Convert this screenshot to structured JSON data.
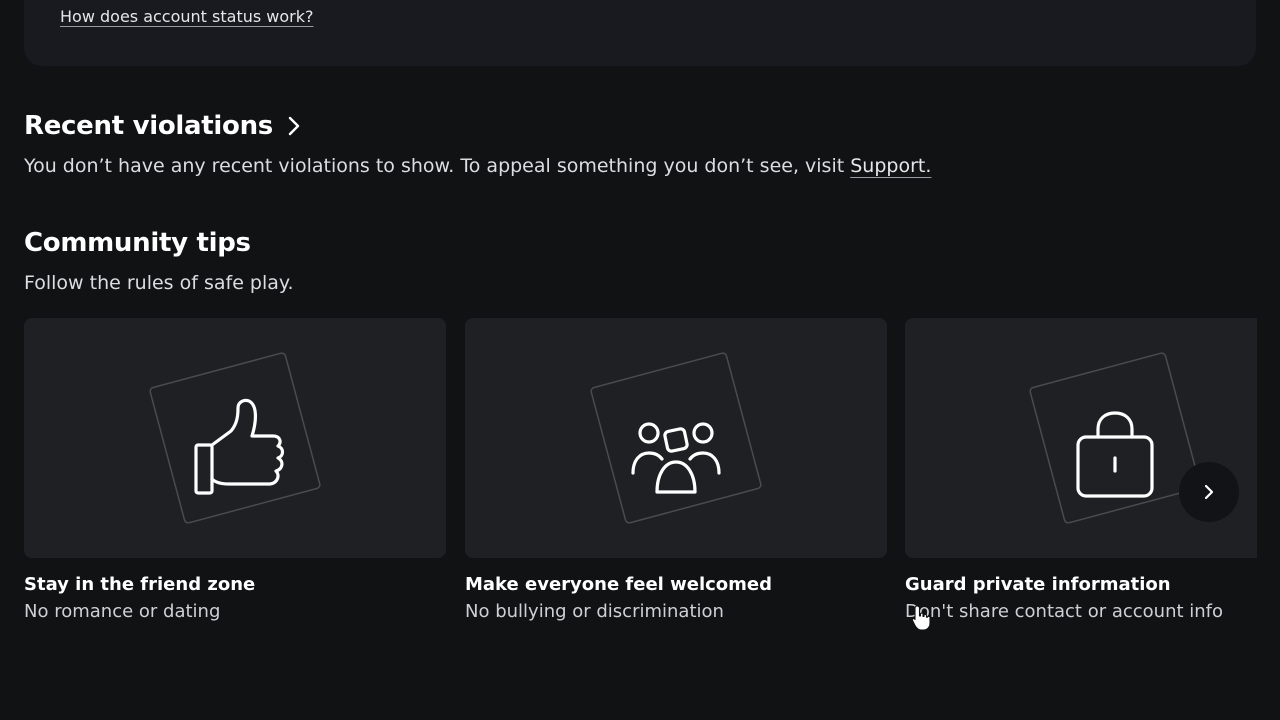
{
  "status_panel": {
    "help_link": "How does account status work?"
  },
  "violations": {
    "title": "Recent violations",
    "text": "You don’t have any recent violations to show. To appeal something you don’t see, visit ",
    "support_link": "Support."
  },
  "tips": {
    "title": "Community tips",
    "subtitle": "Follow the rules of safe play.",
    "cards": [
      {
        "title": "Stay in the friend zone",
        "subtitle": "No romance or dating",
        "icon": "thumbs-up-icon"
      },
      {
        "title": "Make everyone feel welcomed",
        "subtitle": "No bullying or discrimination",
        "icon": "people-group-icon"
      },
      {
        "title": "Guard private information",
        "subtitle": "Don't share contact or account info",
        "icon": "lock-icon"
      }
    ]
  },
  "colors": {
    "background": "#111214",
    "panel": "#191a1f",
    "card": "#1f2024",
    "text": "#ffffff",
    "muted_text": "#cfd0d4"
  }
}
